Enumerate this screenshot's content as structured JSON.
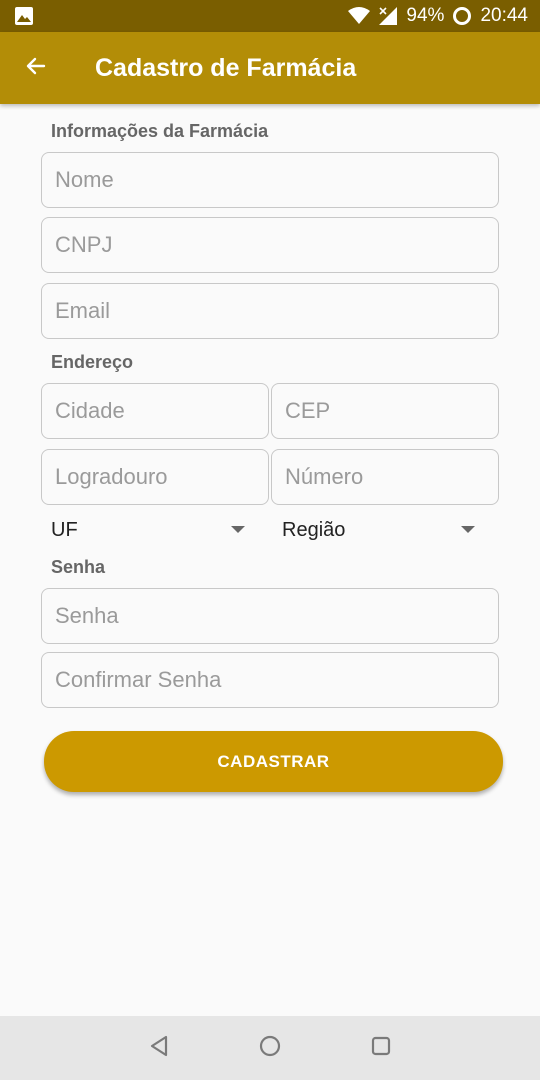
{
  "status_bar": {
    "battery": "94%",
    "time": "20:44",
    "icons": [
      "image-notification-icon",
      "wifi-icon",
      "signal-icon",
      "battery-saver-icon"
    ]
  },
  "app_bar": {
    "title": "Cadastro de Farmácia",
    "back_icon": "arrow-left-icon"
  },
  "form": {
    "pharmacy_section": "Informações da Farmácia",
    "nome_placeholder": "Nome",
    "cnpj_placeholder": "CNPJ",
    "email_placeholder": "Email",
    "address_section": "Endereço",
    "cidade_placeholder": "Cidade",
    "cep_placeholder": "CEP",
    "logradouro_placeholder": "Logradouro",
    "numero_placeholder": "Número",
    "uf_label": "UF",
    "regiao_label": "Região",
    "password_section": "Senha",
    "senha_placeholder": "Senha",
    "confirmar_placeholder": "Confirmar Senha",
    "submit_label": "CADASTRAR"
  },
  "colors": {
    "status_bar": "#7a5e00",
    "app_bar": "#b38d07",
    "button": "#cc9900",
    "background": "#fafafa",
    "nav_bar": "#e6e6e6"
  },
  "nav_bar": {
    "icons": [
      "back-triangle-icon",
      "home-circle-icon",
      "recents-square-icon"
    ]
  }
}
